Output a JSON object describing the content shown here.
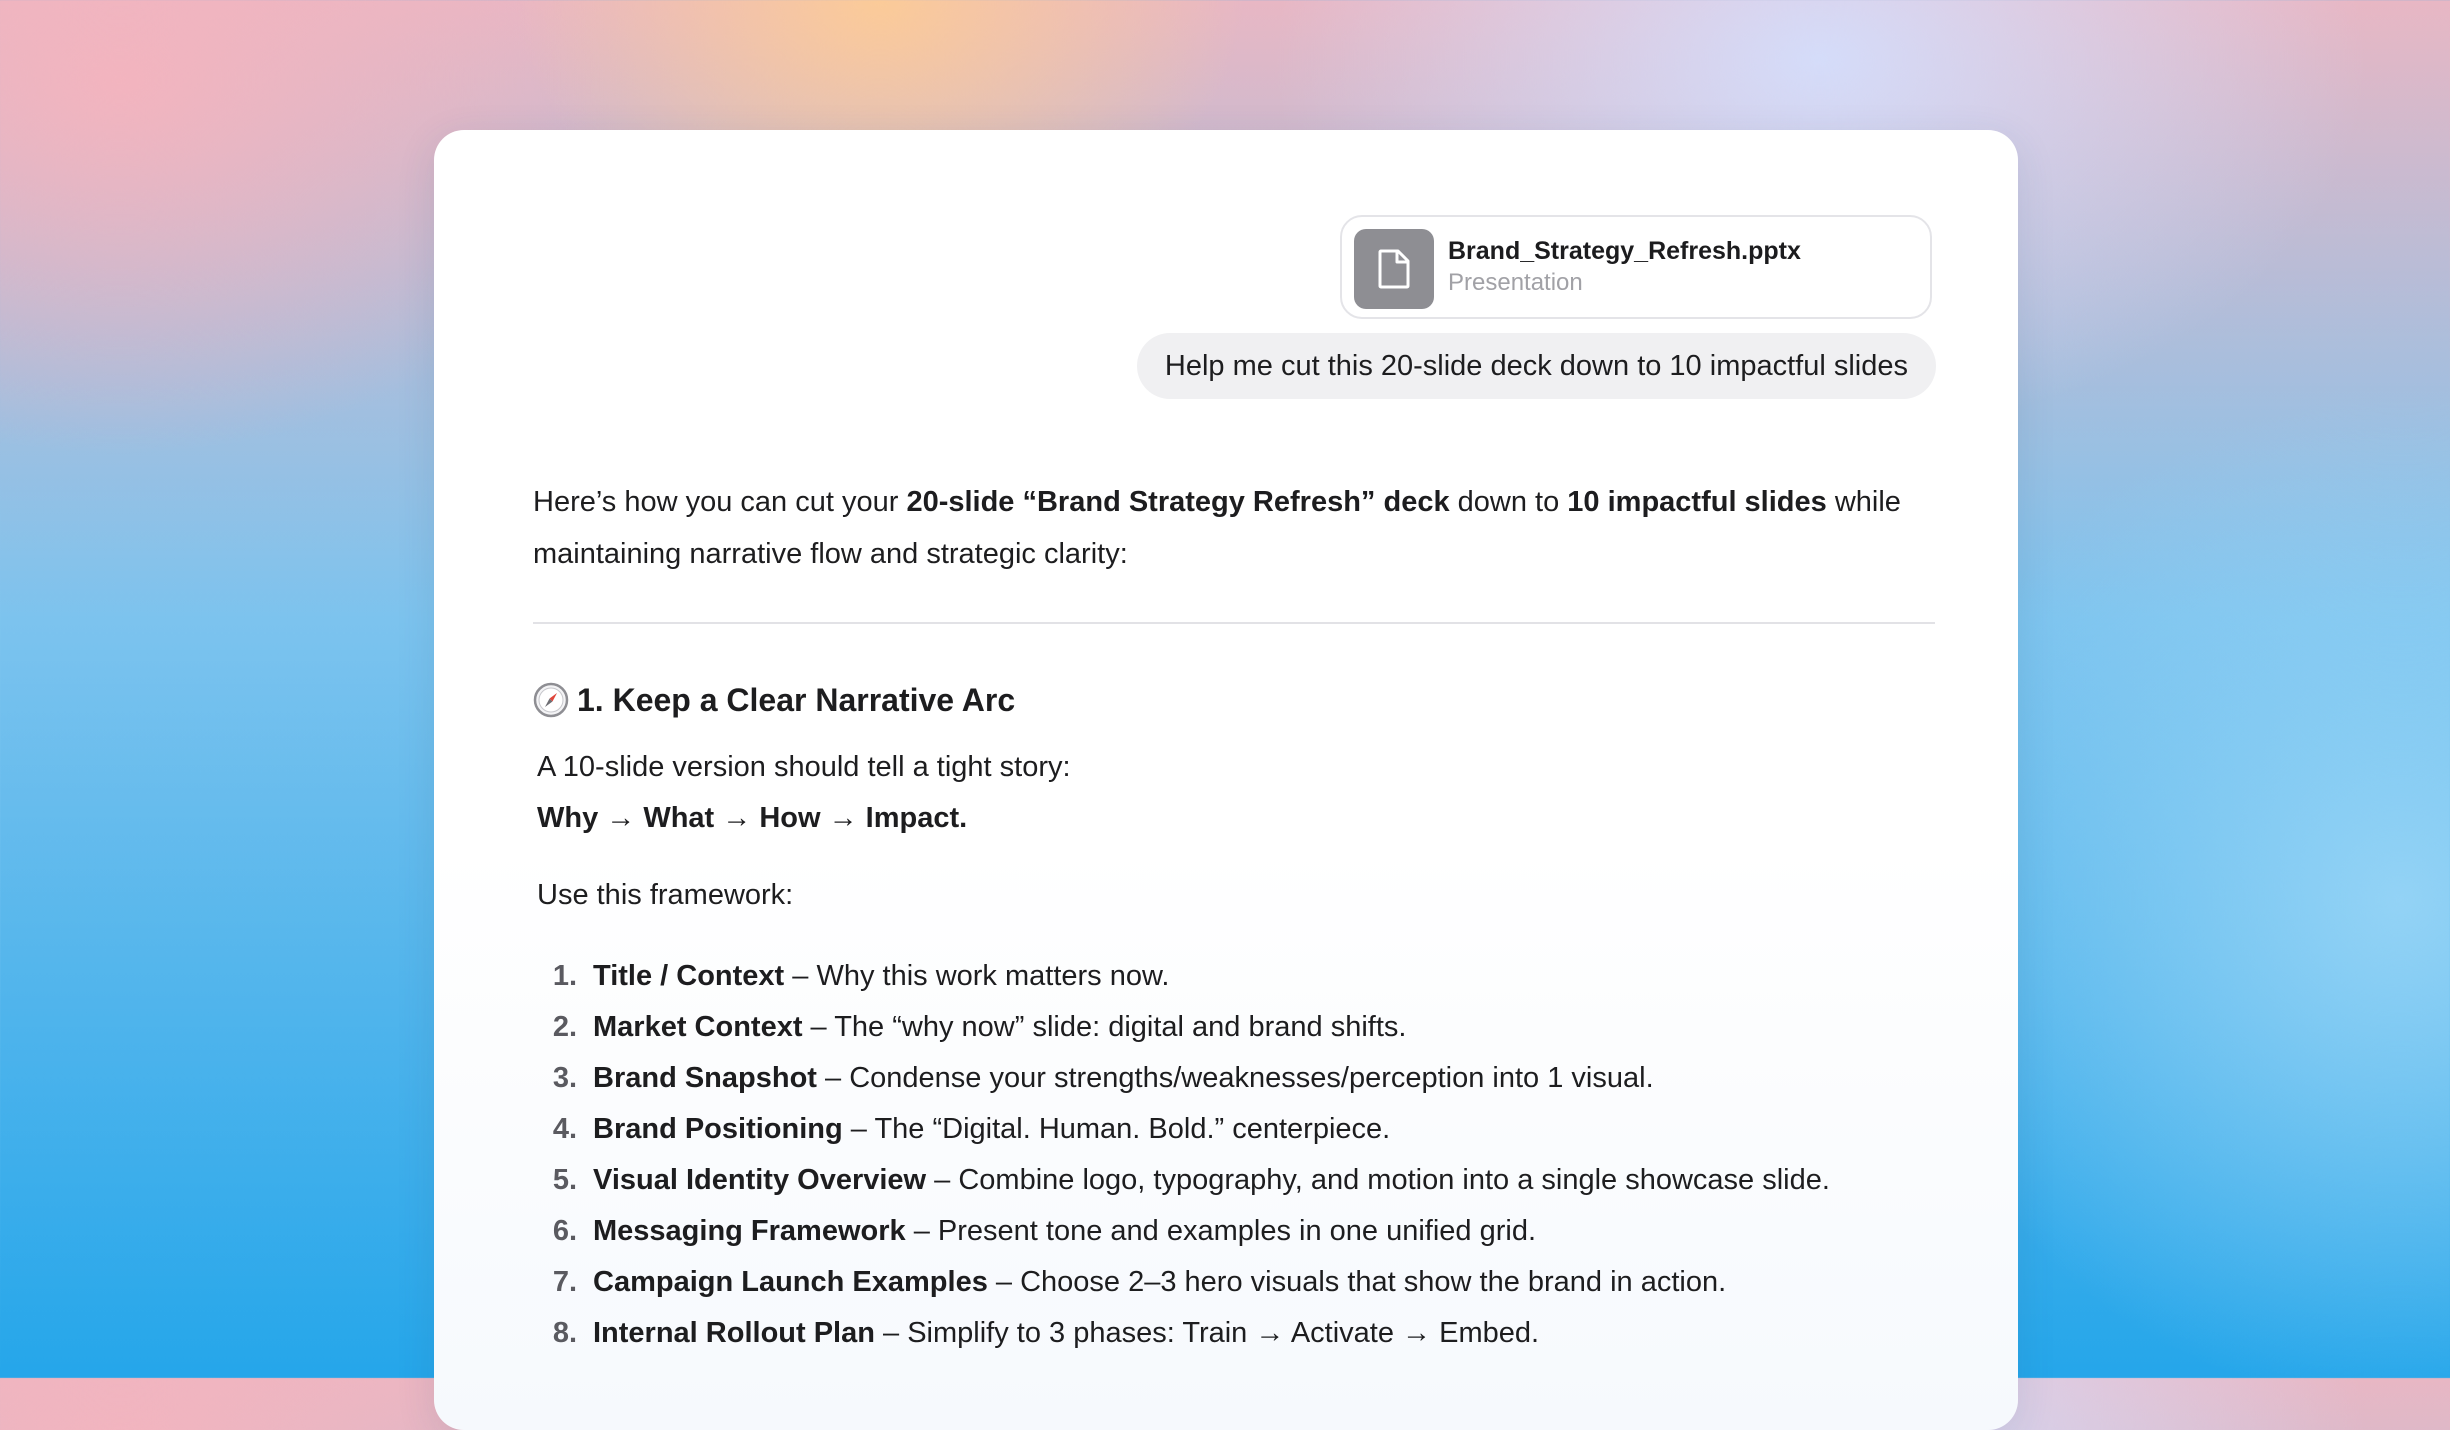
{
  "attachment": {
    "file_name": "Brand_Strategy_Refresh.pptx",
    "file_type": "Presentation",
    "icon": "document-icon"
  },
  "user_prompt": "Help me cut this 20-slide deck down to 10 impactful slides",
  "answer": {
    "intro": {
      "t1": "Here’s how you can cut your ",
      "b1": "20-slide “Brand Strategy Refresh” deck",
      "t2": " down to ",
      "b2": "10 impactful slides",
      "t3": " while maintaining narrative flow and strategic clarity:"
    },
    "section_icon": "compass-icon",
    "section_title": "1. Keep a Clear Narrative Arc",
    "para1_line1": "A 10-slide version should tell a tight story:",
    "para1_line2": "Why → What → How → Impact.",
    "para2": "Use this framework:",
    "steps": [
      {
        "num": "1.",
        "term": "Title / Context",
        "desc": " – Why this work matters now."
      },
      {
        "num": "2.",
        "term": "Market Context",
        "desc": " – The “why now” slide: digital and brand shifts."
      },
      {
        "num": "3.",
        "term": "Brand Snapshot",
        "desc": " – Condense your strengths/weaknesses/perception into 1 visual."
      },
      {
        "num": "4.",
        "term": "Brand Positioning",
        "desc": " – The “Digital. Human. Bold.” centerpiece."
      },
      {
        "num": "5.",
        "term": "Visual Identity Overview",
        "desc": " – Combine logo, typography, and motion into a single showcase slide."
      },
      {
        "num": "6.",
        "term": "Messaging Framework",
        "desc": " – Present tone and examples in one unified grid."
      },
      {
        "num": "7.",
        "term": "Campaign Launch Examples",
        "desc": " – Choose 2–3 hero visuals that show the brand in action."
      },
      {
        "num": "8.",
        "term": "Internal Rollout Plan",
        "desc": " – Simplify to 3 phases: Train → Activate → Embed."
      }
    ]
  }
}
